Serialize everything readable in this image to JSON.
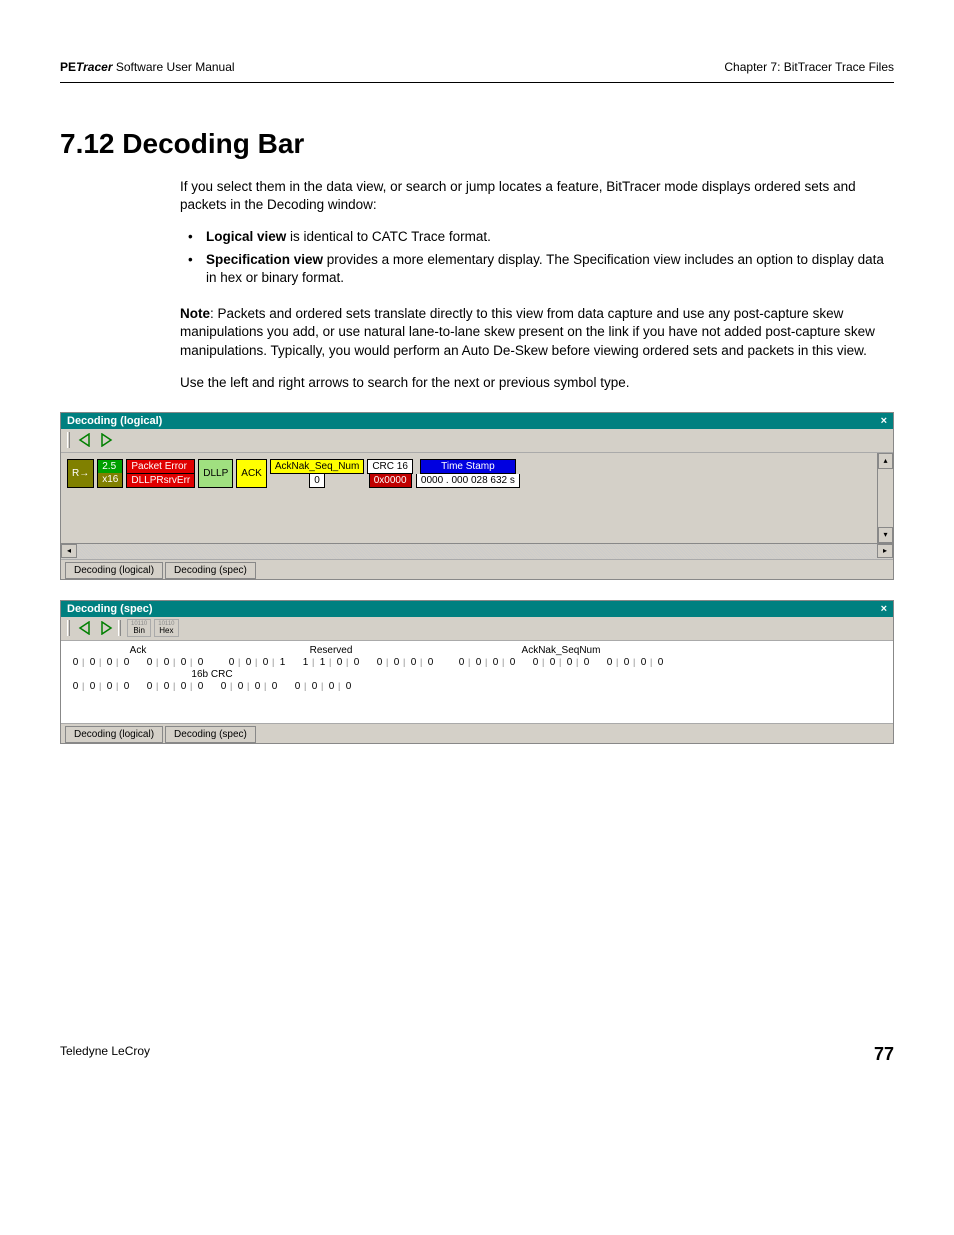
{
  "header": {
    "product_prefix": "PE",
    "product_italic": "Tracer",
    "product_suffix": " Software User Manual",
    "chapter": "Chapter 7: BitTracer Trace Files"
  },
  "heading": "7.12 Decoding Bar",
  "intro": "If you select them in the data view, or search or jump locates a feature, BitTracer mode displays ordered sets and packets in the Decoding window:",
  "bullets": {
    "b1_bold": "Logical view",
    "b1_rest": " is identical to CATC Trace format.",
    "b2_bold": "Specification view",
    "b2_rest": " provides a more elementary display. The Specification view includes an option to display data in hex or binary format."
  },
  "note_label": "Note",
  "note_text": ": Packets and ordered sets translate directly to this view from data capture and use any post-capture skew manipulations you add, or use natural lane-to-lane skew present on the link if you have not added post-capture skew manipulations. Typically, you would perform an Auto De-Skew before viewing ordered sets and packets in this view.",
  "arrows_text": "Use the left and right arrows to search for the next or previous symbol type.",
  "panel_logical": {
    "title": "Decoding (logical)",
    "close": "×",
    "tabs": {
      "t1": "Decoding (logical)",
      "t2": "Decoding (spec)"
    },
    "cells": {
      "r_arrow": "R→",
      "rate": "2.5",
      "lanes": "x16",
      "err1": "Packet Error",
      "err2": "DLLPRsrvErr",
      "dllp": "DLLP",
      "ack": "ACK",
      "seq_label": "AckNak_Seq_Num",
      "seq_val": "0",
      "crc_label": "CRC 16",
      "crc_val": "0x0000",
      "ts_label": "Time Stamp",
      "ts_val": "0000 . 000 028 632 s"
    }
  },
  "panel_spec": {
    "title": "Decoding (spec)",
    "close": "×",
    "bin": "Bin",
    "hex": "Hex",
    "tabs": {
      "t1": "Decoding (logical)",
      "t2": "Decoding (spec)"
    },
    "groups": {
      "ack": "Ack",
      "reserved": "Reserved",
      "seq": "AckNak_SeqNum",
      "crc": "16b CRC"
    },
    "bits": {
      "ack": [
        "0",
        "0",
        "0",
        "0",
        "0",
        "0",
        "0",
        "0"
      ],
      "reserved": [
        "0",
        "0",
        "0",
        "1",
        "1",
        "1",
        "0",
        "0",
        "0",
        "0",
        "0",
        "0"
      ],
      "seq": [
        "0",
        "0",
        "0",
        "0",
        "0",
        "0",
        "0",
        "0",
        "0",
        "0",
        "0",
        "0"
      ],
      "crc": [
        "0",
        "0",
        "0",
        "0",
        "0",
        "0",
        "0",
        "0",
        "0",
        "0",
        "0",
        "0",
        "0",
        "0",
        "0",
        "0"
      ]
    }
  },
  "footer": {
    "company": "Teledyne LeCroy",
    "page": "77"
  }
}
